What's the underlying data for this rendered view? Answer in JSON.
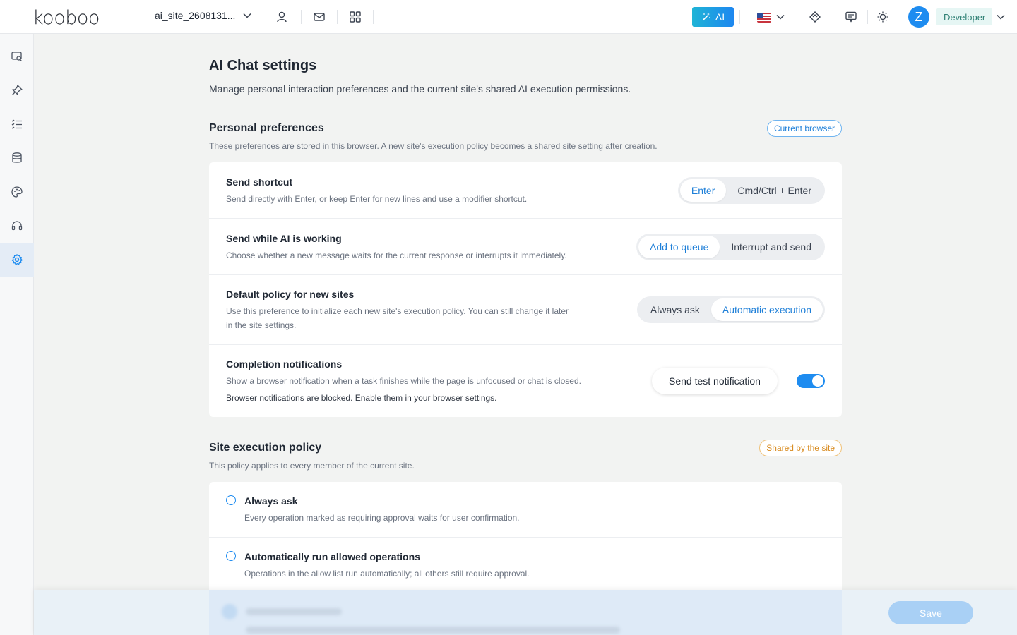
{
  "header": {
    "logo": "kooboo",
    "site_name": "ai_site_2608131...",
    "ai_label": "AI",
    "user_initial": "Z",
    "role": "Developer"
  },
  "icons": {
    "site_dropdown": "chevron-down-icon",
    "users": "user-icon",
    "mail": "mail-icon",
    "apps": "grid-icon",
    "ai": "magic-wand-icon",
    "language": "us-flag-icon",
    "gem": "diamond-icon",
    "messages": "message-icon",
    "theme": "sun-icon",
    "role_dropdown": "chevron-down-icon",
    "sidebar": [
      "monitor-search-icon",
      "pin-icon",
      "list-check-icon",
      "database-icon",
      "palette-icon",
      "headset-icon",
      "gear-icon"
    ]
  },
  "page": {
    "title": "AI Chat settings",
    "description": "Manage personal interaction preferences and the current site's shared AI execution permissions."
  },
  "personal": {
    "title": "Personal preferences",
    "badge": "Current browser",
    "description": "These preferences are stored in this browser. A new site's execution policy becomes a shared site setting after creation.",
    "send_shortcut": {
      "title": "Send shortcut",
      "description": "Send directly with Enter, or keep Enter for new lines and use a modifier shortcut.",
      "options": [
        "Enter",
        "Cmd/Ctrl + Enter"
      ],
      "selected": "Enter"
    },
    "send_while_working": {
      "title": "Send while AI is working",
      "description": "Choose whether a new message waits for the current response or interrupts it immediately.",
      "options": [
        "Add to queue",
        "Interrupt and send"
      ],
      "selected": "Add to queue"
    },
    "default_policy": {
      "title": "Default policy for new sites",
      "description_line1": "Use this preference to initialize each new site's execution policy. You can still change it later",
      "description_line2": "in the site settings.",
      "options": [
        "Always ask",
        "Automatic execution"
      ],
      "selected": "Automatic execution"
    },
    "notifications": {
      "title": "Completion notifications",
      "description": "Show a browser notification when a task finishes while the page is unfocused or chat is closed.",
      "note": "Browser notifications are blocked. Enable them in your browser settings.",
      "test_button": "Send test notification",
      "enabled": true
    }
  },
  "site_policy": {
    "title": "Site execution policy",
    "badge": "Shared by the site",
    "description": "This policy applies to every member of the current site.",
    "options": [
      {
        "title": "Always ask",
        "description": "Every operation marked as requiring approval waits for user confirmation."
      },
      {
        "title": "Automatically run allowed operations",
        "description": "Operations in the allow list run automatically; all others still require approval."
      }
    ]
  },
  "footer": {
    "save_label": "Save"
  },
  "colors": {
    "accent": "#1e8cf0",
    "save_disabled": "#a9d0f5",
    "shared_badge": "#d88a1e"
  }
}
